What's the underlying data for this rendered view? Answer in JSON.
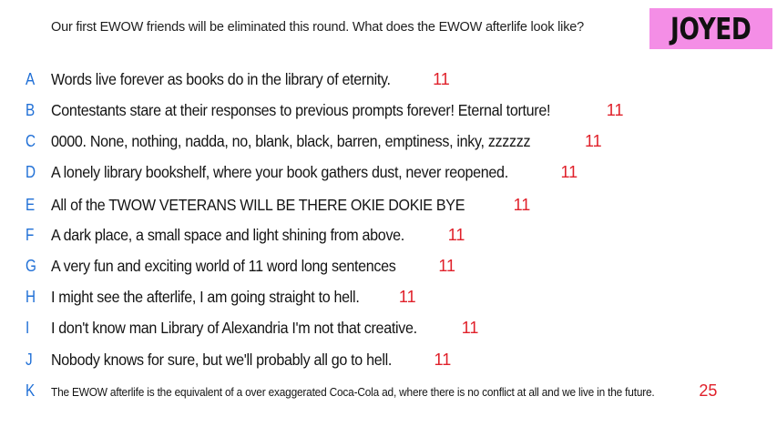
{
  "prompt": "Our first EWOW friends will be eliminated this round. What does the EWOW afterlife look like?",
  "badge": {
    "label": "JOYED",
    "color": "#f48ee6"
  },
  "colors": {
    "letter": "#1f6fd6",
    "count": "#e0202a",
    "text": "#141414"
  },
  "responses": [
    {
      "letter": "A",
      "text": "Words live forever as books do in the library of eternity.",
      "count": "11"
    },
    {
      "letter": "B",
      "text": "Contestants stare at their responses to previous prompts forever! Eternal torture!",
      "count": "11"
    },
    {
      "letter": "C",
      "text": "0000. None, nothing, nadda, no, blank, black, barren, emptiness, inky, zzzzzz",
      "count": "11"
    },
    {
      "letter": "D",
      "text": "A lonely library bookshelf, where your book gathers dust, never reopened.",
      "count": "11"
    },
    {
      "letter": "E",
      "text": "All of the TWOW VETERANS WILL BE THERE OKIE DOKIE BYE",
      "count": "11"
    },
    {
      "letter": "F",
      "text": "A dark place, a small space and light shining from above.",
      "count": "11"
    },
    {
      "letter": "G",
      "text": "A very fun and exciting world of 11 word long sentences",
      "count": "11"
    },
    {
      "letter": "H",
      "text": "I might see the afterlife, I am going straight to hell.",
      "count": "11"
    },
    {
      "letter": "I",
      "text": "I don't know man Library of Alexandria I'm not that creative.",
      "count": "11"
    },
    {
      "letter": "J",
      "text": "Nobody knows for sure, but we'll probably all go to hell.",
      "count": "11"
    },
    {
      "letter": "K",
      "text": "The EWOW afterlife is the equivalent of a over exaggerated Coca-Cola ad, where there is no conflict at all and we live in the future.",
      "count": "25"
    }
  ]
}
